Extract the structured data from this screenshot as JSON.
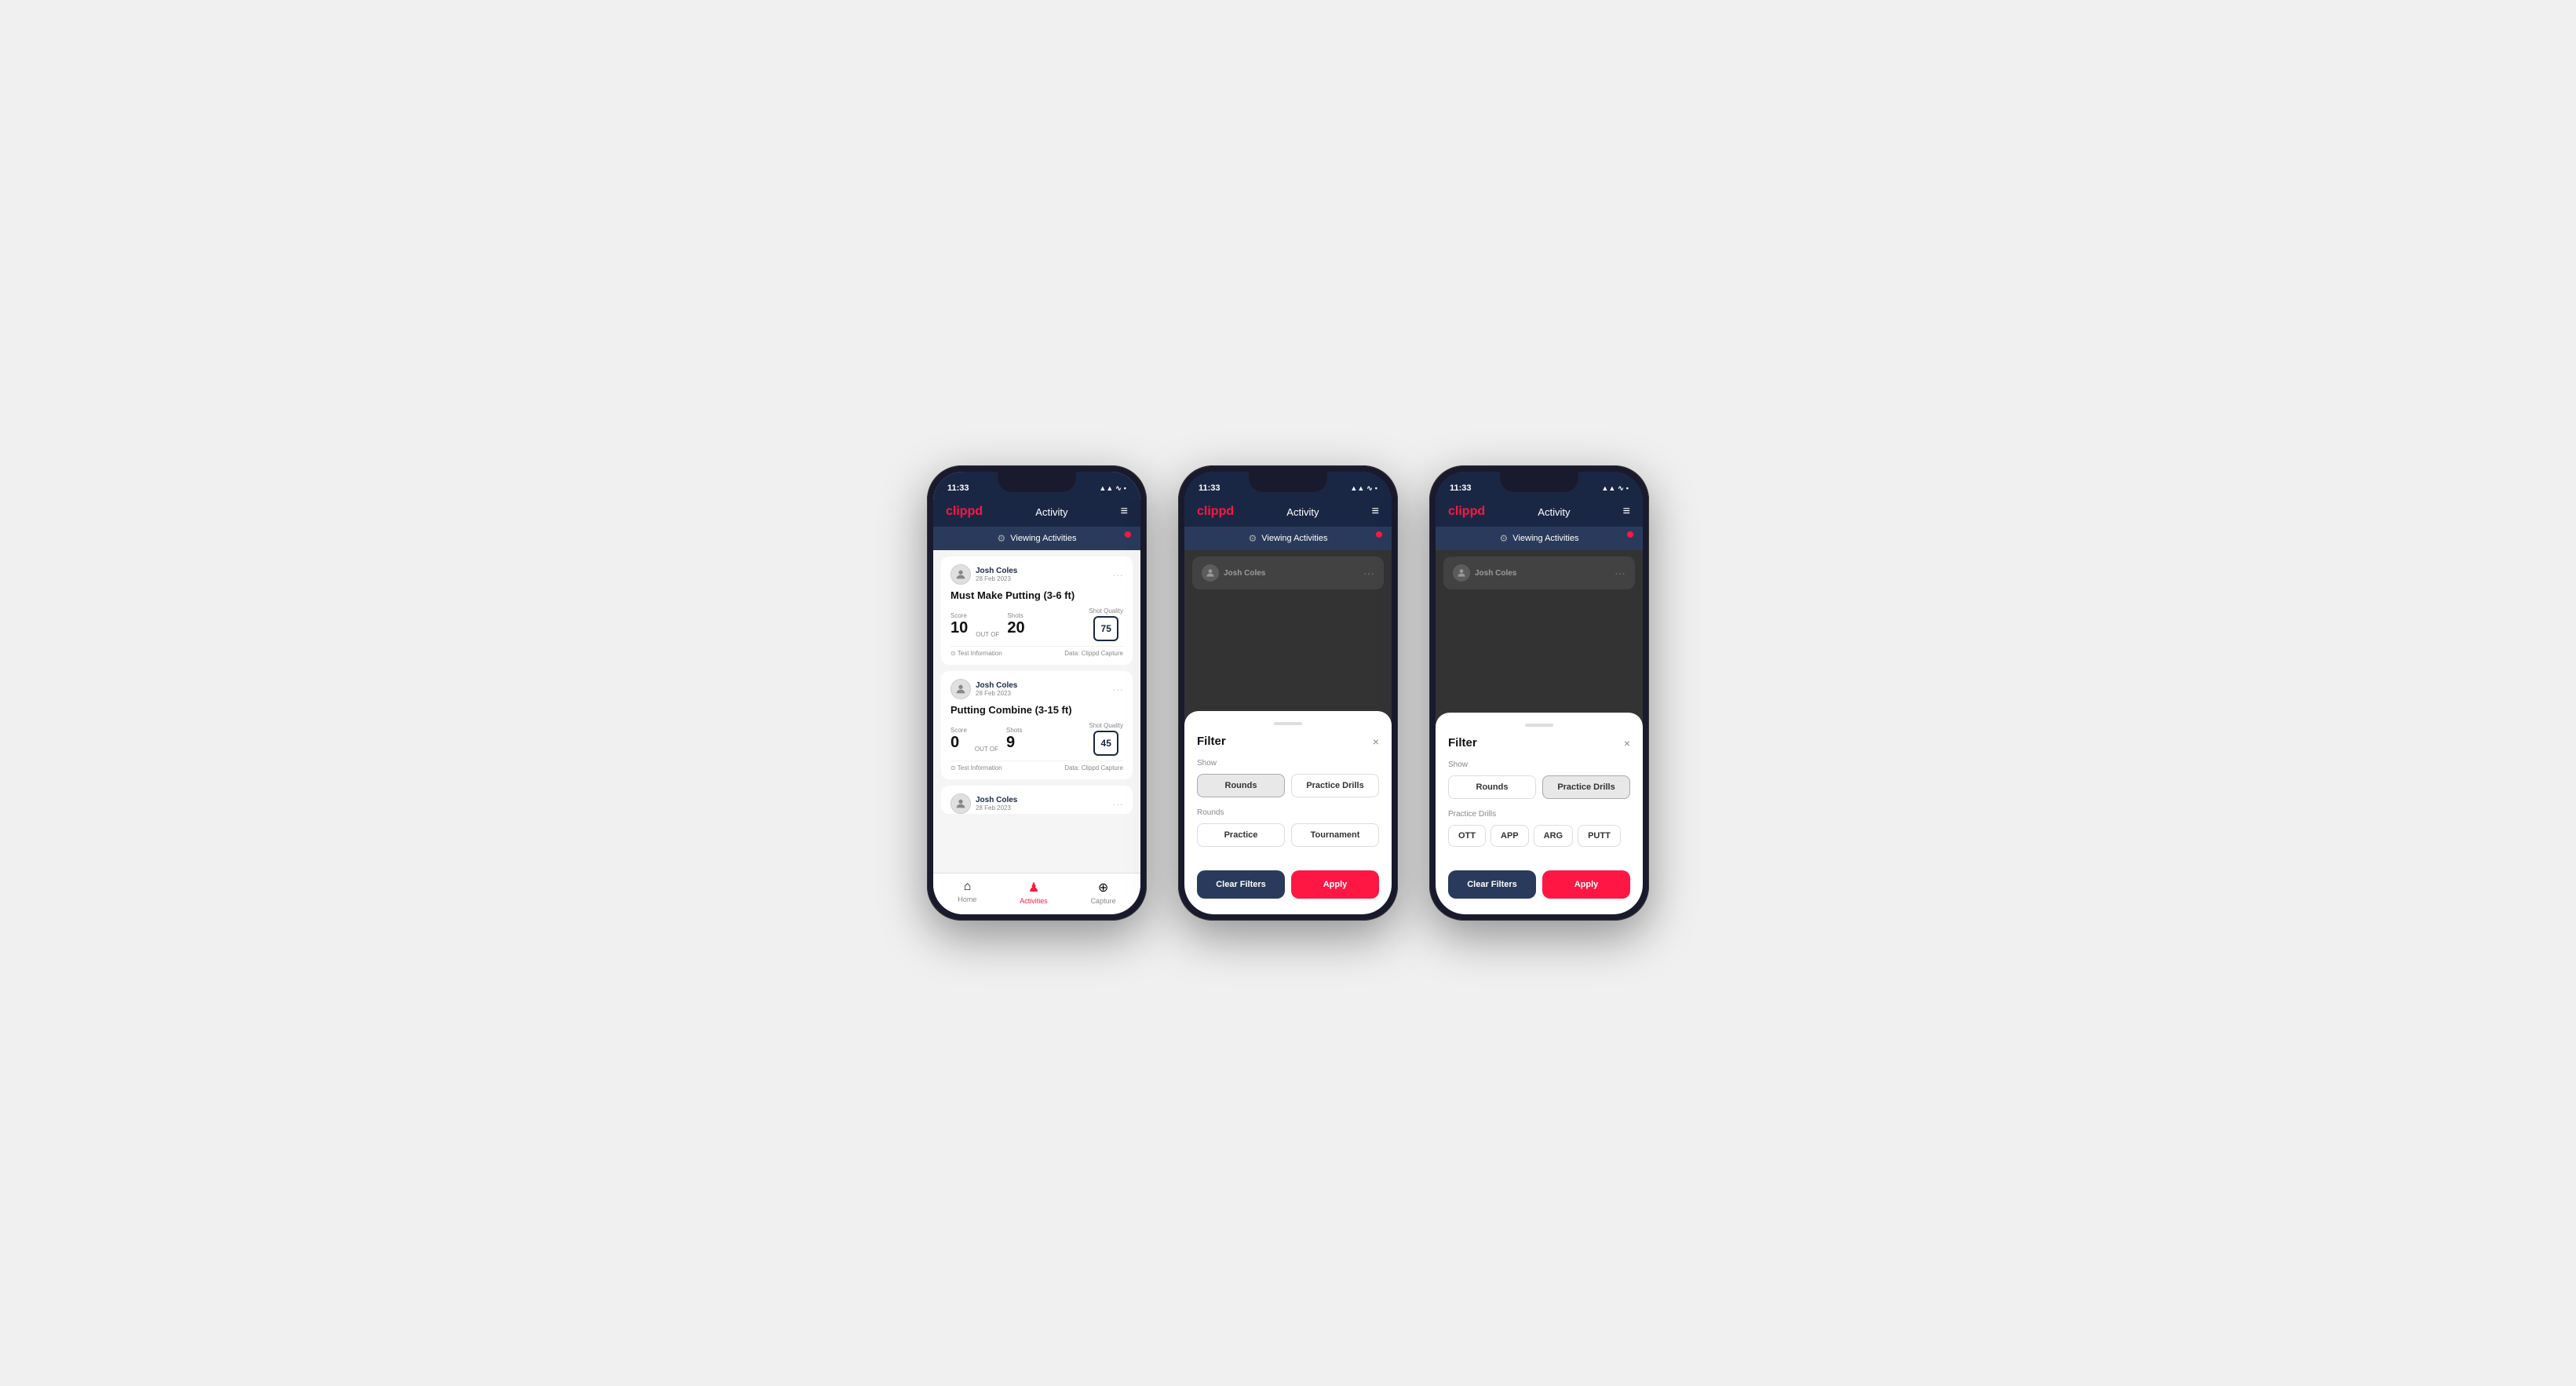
{
  "phones": [
    {
      "id": "phone1",
      "statusBar": {
        "time": "11:33",
        "icons": "▲ ☰ ⬛"
      },
      "header": {
        "logo": "clippd",
        "title": "Activity",
        "menuIcon": "≡"
      },
      "viewingBar": {
        "text": "Viewing Activities",
        "icon": "⚙"
      },
      "activities": [
        {
          "user": "Josh Coles",
          "date": "28 Feb 2023",
          "title": "Must Make Putting (3-6 ft)",
          "scoreLabel": "Score",
          "scoreValue": "10",
          "outOf": "OUT OF",
          "shotsLabel": "Shots",
          "shotsValue": "20",
          "shotQualityLabel": "Shot Quality",
          "shotQualityValue": "75",
          "infoLabel": "⊙ Test Information",
          "dataLabel": "Data: Clippd Capture"
        },
        {
          "user": "Josh Coles",
          "date": "28 Feb 2023",
          "title": "Putting Combine (3-15 ft)",
          "scoreLabel": "Score",
          "scoreValue": "0",
          "outOf": "OUT OF",
          "shotsLabel": "Shots",
          "shotsValue": "9",
          "shotQualityLabel": "Shot Quality",
          "shotQualityValue": "45",
          "infoLabel": "⊙ Test Information",
          "dataLabel": "Data: Clippd Capture"
        },
        {
          "user": "Josh Coles",
          "date": "28 Feb 2023",
          "title": "",
          "scoreLabel": "",
          "scoreValue": "",
          "outOf": "",
          "shotsLabel": "",
          "shotsValue": "",
          "shotQualityLabel": "",
          "shotQualityValue": "",
          "infoLabel": "",
          "dataLabel": ""
        }
      ],
      "bottomNav": {
        "items": [
          {
            "icon": "⌂",
            "label": "Home",
            "active": false
          },
          {
            "icon": "♟",
            "label": "Activities",
            "active": true
          },
          {
            "icon": "⊕",
            "label": "Capture",
            "active": false
          }
        ]
      },
      "hasFilter": false
    },
    {
      "id": "phone2",
      "statusBar": {
        "time": "11:33",
        "icons": "▲ ☰ ⬛"
      },
      "header": {
        "logo": "clippd",
        "title": "Activity",
        "menuIcon": "≡"
      },
      "viewingBar": {
        "text": "Viewing Activities",
        "icon": "⚙"
      },
      "hasFilter": true,
      "filter": {
        "title": "Filter",
        "closeIcon": "×",
        "showLabel": "Show",
        "showButtons": [
          {
            "label": "Rounds",
            "active": true
          },
          {
            "label": "Practice Drills",
            "active": false
          }
        ],
        "roundsLabel": "Rounds",
        "roundButtons": [
          {
            "label": "Practice",
            "active": false
          },
          {
            "label": "Tournament",
            "active": false
          }
        ],
        "drillsLabel": null,
        "drillTags": null,
        "clearFiltersLabel": "Clear Filters",
        "applyLabel": "Apply"
      }
    },
    {
      "id": "phone3",
      "statusBar": {
        "time": "11:33",
        "icons": "▲ ☰ ⬛"
      },
      "header": {
        "logo": "clippd",
        "title": "Activity",
        "menuIcon": "≡"
      },
      "viewingBar": {
        "text": "Viewing Activities",
        "icon": "⚙"
      },
      "hasFilter": true,
      "filter": {
        "title": "Filter",
        "closeIcon": "×",
        "showLabel": "Show",
        "showButtons": [
          {
            "label": "Rounds",
            "active": false
          },
          {
            "label": "Practice Drills",
            "active": true
          }
        ],
        "roundsLabel": null,
        "roundButtons": null,
        "drillsLabel": "Practice Drills",
        "drillTags": [
          {
            "label": "OTT"
          },
          {
            "label": "APP"
          },
          {
            "label": "ARG"
          },
          {
            "label": "PUTT"
          }
        ],
        "clearFiltersLabel": "Clear Filters",
        "applyLabel": "Apply"
      }
    }
  ]
}
